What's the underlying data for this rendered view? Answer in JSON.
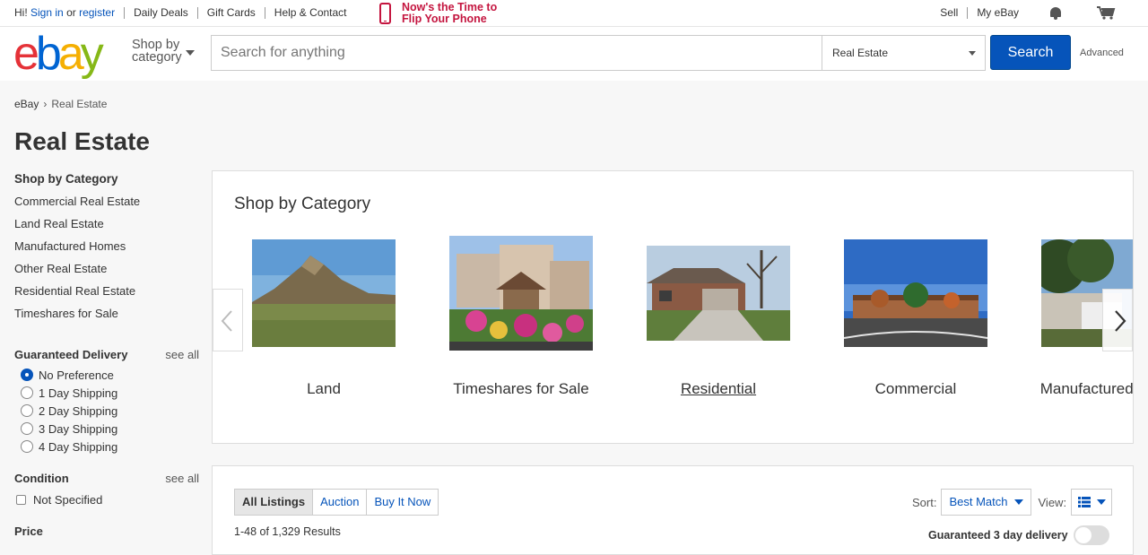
{
  "topbar": {
    "hi": "Hi!",
    "sign_in": "Sign in",
    "or": "or",
    "register": "register",
    "links": [
      "Daily Deals",
      "Gift Cards",
      "Help & Contact"
    ],
    "promo_line1": "Now's the Time to",
    "promo_line2": "Flip Your Phone",
    "sell": "Sell",
    "my_ebay": "My eBay",
    "notification_icon": "bell-icon",
    "cart_icon": "cart-icon"
  },
  "header": {
    "logo": {
      "e": "e",
      "b": "b",
      "a": "a",
      "y": "y"
    },
    "shop_by_line1": "Shop by",
    "shop_by_line2": "category",
    "search_placeholder": "Search for anything",
    "category_select": "Real Estate",
    "search_button": "Search",
    "advanced": "Advanced"
  },
  "breadcrumb": [
    "eBay",
    "Real Estate"
  ],
  "page_title": "Real Estate",
  "sidebar": {
    "shop_by_category_title": "Shop by Category",
    "categories": [
      "Commercial Real Estate",
      "Land Real Estate",
      "Manufactured Homes",
      "Other Real Estate",
      "Residential Real Estate",
      "Timeshares for Sale"
    ],
    "guaranteed_delivery": {
      "title": "Guaranteed Delivery",
      "see_all": "see all",
      "options": [
        "No Preference",
        "1 Day Shipping",
        "2 Day Shipping",
        "3 Day Shipping",
        "4 Day Shipping"
      ],
      "selected": "No Preference"
    },
    "condition": {
      "title": "Condition",
      "see_all": "see all",
      "options": [
        "Not Specified"
      ]
    },
    "price_title": "Price"
  },
  "category_panel": {
    "title": "Shop by Category",
    "tiles": [
      "Land",
      "Timeshares for Sale",
      "Residential",
      "Commercial",
      "Manufactured Homes"
    ],
    "prev_icon": "chevron-left-icon",
    "next_icon": "chevron-right-icon"
  },
  "listings": {
    "tabs": [
      "All Listings",
      "Auction",
      "Buy It Now"
    ],
    "active_tab": "All Listings",
    "results": "1-48 of 1,329 Results",
    "sort_label": "Sort:",
    "sort_value": "Best Match",
    "view_label": "View:",
    "view_icon": "list-view-icon",
    "guaranteed_label": "Guaranteed 3 day delivery"
  },
  "colors": {
    "link_blue": "#0654ba",
    "promo_red": "#c4153f",
    "logo_red": "#e53238",
    "logo_blue": "#0064d2",
    "logo_yellow": "#f5af02",
    "logo_green": "#86b817"
  }
}
